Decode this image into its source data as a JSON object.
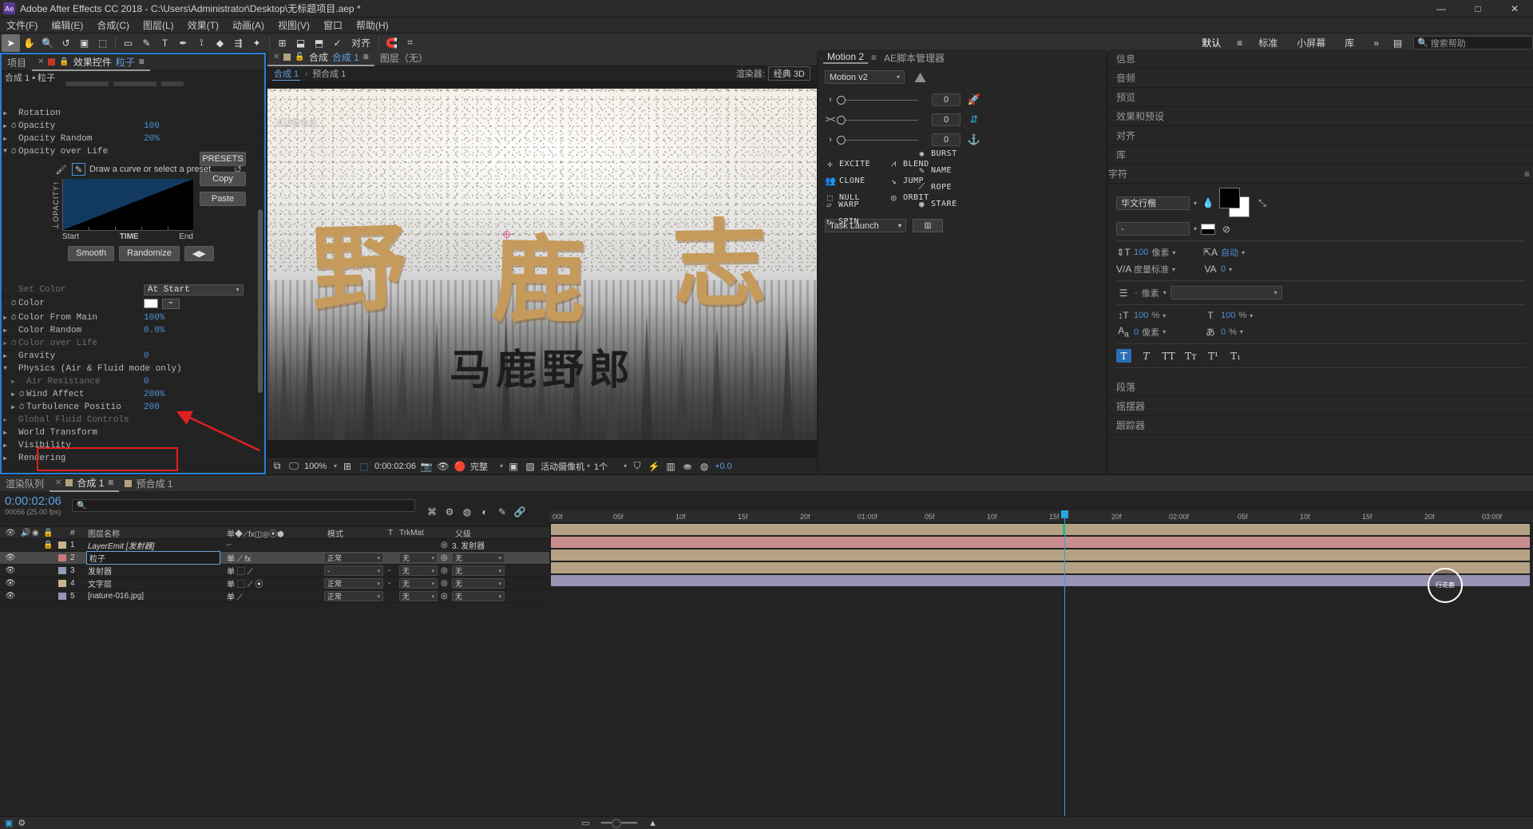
{
  "titlebar": {
    "logo": "Ae",
    "title": "Adobe After Effects CC 2018 - C:\\Users\\Administrator\\Desktop\\无标题项目.aep *",
    "minimize": "—",
    "maximize": "□",
    "close": "✕"
  },
  "menubar": {
    "items": [
      "文件(F)",
      "编辑(E)",
      "合成(C)",
      "图层(L)",
      "效果(T)",
      "动画(A)",
      "视图(V)",
      "窗口",
      "帮助(H)"
    ]
  },
  "toolbar": {
    "tools": [
      "➤",
      "✋",
      "🔍",
      "↺",
      "▣",
      "⬚",
      "▭",
      "✎",
      "T",
      "✒",
      "⟟",
      "◆",
      "⇶",
      "✦"
    ],
    "align_label": "对齐",
    "right_items": [
      "默认",
      "标准",
      "小屏幕",
      "库"
    ],
    "selected_workspace": "默认",
    "overflow": "»",
    "search_placeholder": "搜索帮助",
    "search_icon": "search-icon"
  },
  "effect_controls": {
    "tabs": [
      {
        "label": "项目",
        "selected": false,
        "closable": false
      },
      {
        "label": "效果控件",
        "value": "粒子",
        "selected": true,
        "closable": true
      }
    ],
    "breadcrumb": "合成 1 • 粒子",
    "curve": {
      "hint": "Draw a curve or select a preset",
      "y_axis": "OPACITY",
      "x_axis_start": "Start",
      "x_axis_mid": "TIME",
      "x_axis_end": "End",
      "presets_label": "PRESETS",
      "copy_label": "Copy",
      "paste_label": "Paste",
      "smooth_label": "Smooth",
      "randomize_label": "Randomize"
    },
    "rows": [
      {
        "tri": "▶",
        "stop": false,
        "name": "Rotation",
        "value": "",
        "dim": false
      },
      {
        "tri": "▶",
        "stop": true,
        "name": "Opacity",
        "value": "100",
        "dim": false
      },
      {
        "tri": "▶",
        "stop": false,
        "name": "Opacity Random",
        "value": "20%",
        "dim": false
      },
      {
        "tri": "▼",
        "stop": true,
        "name": "Opacity over Life",
        "value": "",
        "dim": false
      }
    ],
    "rows2": [
      {
        "tri": "·",
        "stop": false,
        "name": "Set Color",
        "value": "At Start",
        "type": "dropdown",
        "dim": false
      },
      {
        "tri": "·",
        "stop": true,
        "name": "Color",
        "value": "",
        "type": "color",
        "dim": false
      },
      {
        "tri": "▶",
        "stop": true,
        "name": "Color From Main",
        "value": "100%",
        "dim": false
      },
      {
        "tri": "▶",
        "stop": false,
        "name": "Color Random",
        "value": "0.0%",
        "dim": false
      },
      {
        "tri": "▶",
        "stop": true,
        "name": "Color over Life",
        "value": "",
        "dim": true
      },
      {
        "tri": "▶",
        "stop": false,
        "name": "Gravity",
        "value": "0",
        "dim": false
      },
      {
        "tri": "▼",
        "stop": false,
        "name": "Physics (Air & Fluid mode only)",
        "value": "",
        "dim": false
      },
      {
        "tri": "▶",
        "stop": false,
        "name": "  Air Resistance",
        "value": "0",
        "dim": true
      },
      {
        "tri": "▶",
        "stop": true,
        "name": "  Wind Affect",
        "value": "200%",
        "dim": false
      },
      {
        "tri": "▶",
        "stop": true,
        "name": "  Turbulence Positio",
        "value": "200",
        "dim": false
      },
      {
        "tri": "▶",
        "stop": false,
        "name": "Global Fluid Controls",
        "value": "",
        "dim": true
      },
      {
        "tri": "▶",
        "stop": false,
        "name": "World Transform",
        "value": "",
        "dim": false
      },
      {
        "tri": "▶",
        "stop": false,
        "name": "Visibility",
        "value": "",
        "dim": false
      },
      {
        "tri": "▶",
        "stop": false,
        "name": "Rendering",
        "value": "",
        "dim": false
      }
    ],
    "annotation_color": "#e02020"
  },
  "composition": {
    "tabs": [
      {
        "label": "合成",
        "value": "合成 1",
        "selected": true,
        "closable": true
      }
    ],
    "layer_tab": "图层（无）",
    "breadcrumb": [
      "合成 1",
      "预合成 1"
    ],
    "renderer_label": "渲染器:",
    "renderer_value": "经典 3D",
    "overlay_text": "活动摄像机",
    "title_chars": [
      "野",
      "鹿",
      "志"
    ],
    "subtitle": "马鹿野郎",
    "bottom_bar": {
      "zoom": "100%",
      "time": "0:00:02:06",
      "quality": "完整",
      "camera": "活动摄像机",
      "views": "1个",
      "exposure": "+0.0"
    }
  },
  "motion": {
    "tabs": [
      {
        "label": "Motion 2",
        "selected": true
      },
      {
        "label": "AE脚本管理器",
        "selected": false
      }
    ],
    "version_select": "Motion v2",
    "sliders": [
      {
        "icon": "‹",
        "value": "0",
        "side_icon": "rocket-icon"
      },
      {
        "icon": "><",
        "value": "0",
        "side_icon": "updown-arrow-icon"
      },
      {
        "icon": "›",
        "value": "0",
        "side_icon": "anchor-icon"
      }
    ],
    "buttons": [
      {
        "label": "EXCITE",
        "glyph": "✛"
      },
      {
        "label": "BLEND",
        "glyph": "⩘"
      },
      {
        "label": "CLONE",
        "glyph": "👥"
      },
      {
        "label": "JUMP",
        "glyph": "↘"
      },
      {
        "label": "NULL",
        "glyph": "⬚"
      },
      {
        "label": "ORBIT",
        "glyph": "◎"
      },
      {
        "label": "BURST",
        "glyph": "✺"
      },
      {
        "label": "NAME",
        "glyph": "✎"
      },
      {
        "label": "WARP",
        "glyph": "▱"
      },
      {
        "label": "SPIN",
        "glyph": "↻"
      },
      {
        "label": "ROPE",
        "glyph": "⟋"
      },
      {
        "label": "STARE",
        "glyph": "◉"
      }
    ],
    "task_select": "Task Launch",
    "task_button": "▥"
  },
  "right_panels": {
    "items": [
      "信息",
      "音频",
      "预览",
      "效果和预设",
      "对齐",
      "库"
    ],
    "character": {
      "title": "字符",
      "font_family": "华文行楷",
      "font_style": "-",
      "size_value": "100",
      "size_unit": "像素",
      "leading_value": "自动",
      "kerning_label": "度量标准",
      "tracking_value": "0",
      "stroke_width_value": "-",
      "stroke_width_unit": "像素",
      "stroke_type": "",
      "v_scale": "100",
      "v_scale_unit": "%",
      "h_scale": "100",
      "h_scale_unit": "%",
      "baseline_value": "0",
      "baseline_unit": "像素",
      "tsume_value": "0",
      "tsume_unit": "%",
      "style_buttons": [
        "T",
        "T",
        "TT",
        "Tт",
        "T¹",
        "T₁"
      ]
    },
    "lower_items": [
      "段落",
      "摇摆器",
      "跟踪器"
    ]
  },
  "timeline": {
    "tabs": [
      {
        "label": "渲染队列",
        "selected": false,
        "closable": true
      },
      {
        "label": "合成 1",
        "selected": true,
        "sw": "#b2a180"
      },
      {
        "label": "预合成 1",
        "selected": false,
        "sw": "#b2a180"
      }
    ],
    "timecode": "0:00:02:06",
    "fps_note": "00056 (25.00 fps)",
    "search_placeholder": "",
    "columns": [
      "#",
      "图层名称",
      "模式",
      "T",
      "TrkMat",
      "父级"
    ],
    "toggle_icons": [
      "⌘",
      "⚙",
      "◍",
      "◐",
      "✎",
      "🔗"
    ],
    "layers": [
      {
        "num": "1",
        "name": "LayerEmit [发射器]",
        "sw": "#c8b48e",
        "mode": "",
        "trkmat": "",
        "parent": "3. 发射器",
        "selected": false,
        "bar": "#b5a183",
        "italic": true
      },
      {
        "num": "2",
        "name": "粒子",
        "sw": "#ffffff",
        "mode": "正常",
        "trkmat": "无",
        "parent": "无",
        "selected": true,
        "bar": "#c98d8d"
      },
      {
        "num": "3",
        "name": "发射器",
        "sw": "#8e9fb5",
        "mode": "-",
        "trkmat": "无",
        "parent": "无",
        "selected": false,
        "bar": "#b5a183"
      },
      {
        "num": "4",
        "name": "文字层",
        "sw": "#c8b48e",
        "mode": "正常",
        "trkmat": "无",
        "parent": "无",
        "selected": false,
        "bar": "#b5a183"
      },
      {
        "num": "5",
        "name": "[nature-016.jpg]",
        "sw": "#8e9fb5",
        "mode": "正常",
        "trkmat": "无",
        "parent": "无",
        "selected": false,
        "bar": "#9a93b5"
      }
    ],
    "ruler_ticks": [
      "00f",
      "05f",
      "10f",
      "15f",
      "20f",
      "01:00f",
      "05f",
      "10f",
      "15f",
      "20f",
      "02:00f",
      "05f",
      "10f",
      "15f",
      "20f",
      "03:00f"
    ],
    "watermark": "行走鹿"
  }
}
